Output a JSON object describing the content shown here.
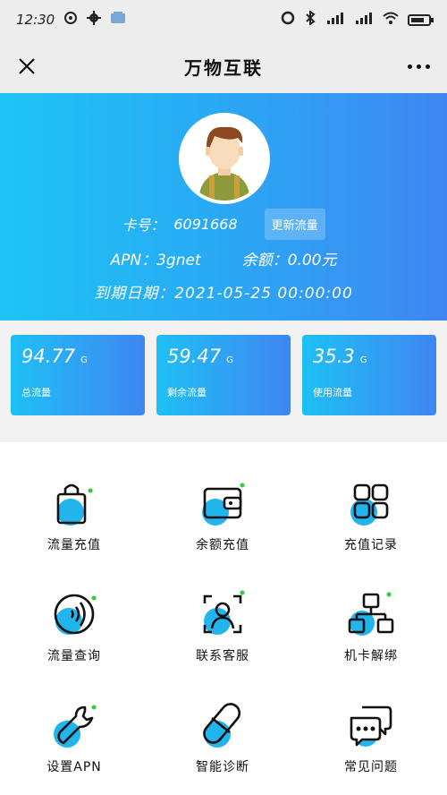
{
  "status_bar": {
    "time": "12:30",
    "network_left": "4G",
    "network_right": "4G"
  },
  "header": {
    "title": "万物互联"
  },
  "profile": {
    "card_label": "卡号：",
    "card_number": "6091668",
    "refresh_button": "更新流量",
    "apn_label": "APN：",
    "apn_value": "3gnet",
    "balance_label": "余额：",
    "balance_value": "0.00元",
    "expiry_label": "到期日期：",
    "expiry_value": "2021-05-25 00:00:00"
  },
  "stats": [
    {
      "value": "94.77",
      "unit": "G",
      "label": "总流量"
    },
    {
      "value": "59.47",
      "unit": "G",
      "label": "剩余流量"
    },
    {
      "value": "35.3",
      "unit": "G",
      "label": "使用流量"
    }
  ],
  "menu": [
    {
      "label": "流量充值",
      "icon": "shopping-bag-icon"
    },
    {
      "label": "余额充值",
      "icon": "wallet-icon"
    },
    {
      "label": "充值记录",
      "icon": "grid-apps-icon"
    },
    {
      "label": "流量查询",
      "icon": "signal-waves-icon"
    },
    {
      "label": "联系客服",
      "icon": "customer-service-icon"
    },
    {
      "label": "机卡解绑",
      "icon": "org-chart-icon"
    },
    {
      "label": "设置APN",
      "icon": "wrench-icon"
    },
    {
      "label": "智能诊断",
      "icon": "capsule-icon"
    },
    {
      "label": "常见问题",
      "icon": "chat-bubbles-icon"
    }
  ],
  "colors": {
    "accent_start": "#1ec4f5",
    "accent_end": "#3f86f2",
    "icon_fill": "#22b4ec",
    "dot_green": "#2ecc40"
  }
}
